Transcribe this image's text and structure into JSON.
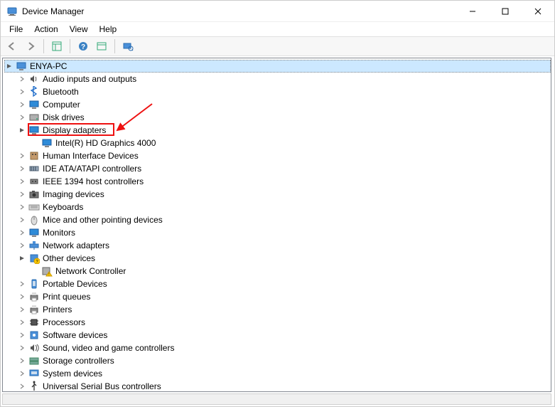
{
  "window": {
    "title": "Device Manager"
  },
  "menu": {
    "file": "File",
    "action": "Action",
    "view": "View",
    "help": "Help"
  },
  "toolbar": {
    "back": "back-icon",
    "forward": "forward-icon",
    "properties": "properties-icon",
    "help": "help-icon",
    "show_hidden": "show-hidden-icon",
    "scan": "scan-icon"
  },
  "tree": {
    "root": {
      "label": "ENYA-PC",
      "expanded": true,
      "selected": true,
      "icon": "computer-icon"
    },
    "items": [
      {
        "label": "Audio inputs and outputs",
        "icon": "speaker-icon",
        "expanded": false
      },
      {
        "label": "Bluetooth",
        "icon": "bluetooth-icon",
        "expanded": false
      },
      {
        "label": "Computer",
        "icon": "monitor-icon",
        "expanded": false
      },
      {
        "label": "Disk drives",
        "icon": "disk-icon",
        "expanded": false
      },
      {
        "label": "Display adapters",
        "icon": "monitor-icon",
        "expanded": true,
        "highlighted": true,
        "children": [
          {
            "label": "Intel(R) HD Graphics 4000",
            "icon": "monitor-icon"
          }
        ]
      },
      {
        "label": "Human Interface Devices",
        "icon": "hid-icon",
        "expanded": false
      },
      {
        "label": "IDE ATA/ATAPI controllers",
        "icon": "ide-icon",
        "expanded": false
      },
      {
        "label": "IEEE 1394 host controllers",
        "icon": "port-icon",
        "expanded": false
      },
      {
        "label": "Imaging devices",
        "icon": "camera-icon",
        "expanded": false
      },
      {
        "label": "Keyboards",
        "icon": "keyboard-icon",
        "expanded": false
      },
      {
        "label": "Mice and other pointing devices",
        "icon": "mouse-icon",
        "expanded": false
      },
      {
        "label": "Monitors",
        "icon": "monitor-icon",
        "expanded": false
      },
      {
        "label": "Network adapters",
        "icon": "network-icon",
        "expanded": false
      },
      {
        "label": "Other devices",
        "icon": "warning-icon",
        "expanded": true,
        "children": [
          {
            "label": "Network Controller",
            "icon": "device-warning-icon"
          }
        ]
      },
      {
        "label": "Portable Devices",
        "icon": "portable-icon",
        "expanded": false
      },
      {
        "label": "Print queues",
        "icon": "printer-icon",
        "expanded": false
      },
      {
        "label": "Printers",
        "icon": "printer-icon",
        "expanded": false
      },
      {
        "label": "Processors",
        "icon": "cpu-icon",
        "expanded": false
      },
      {
        "label": "Software devices",
        "icon": "software-icon",
        "expanded": false
      },
      {
        "label": "Sound, video and game controllers",
        "icon": "sound-icon",
        "expanded": false
      },
      {
        "label": "Storage controllers",
        "icon": "storage-icon",
        "expanded": false
      },
      {
        "label": "System devices",
        "icon": "system-icon",
        "expanded": false
      },
      {
        "label": "Universal Serial Bus controllers",
        "icon": "usb-icon",
        "expanded": false
      }
    ]
  }
}
